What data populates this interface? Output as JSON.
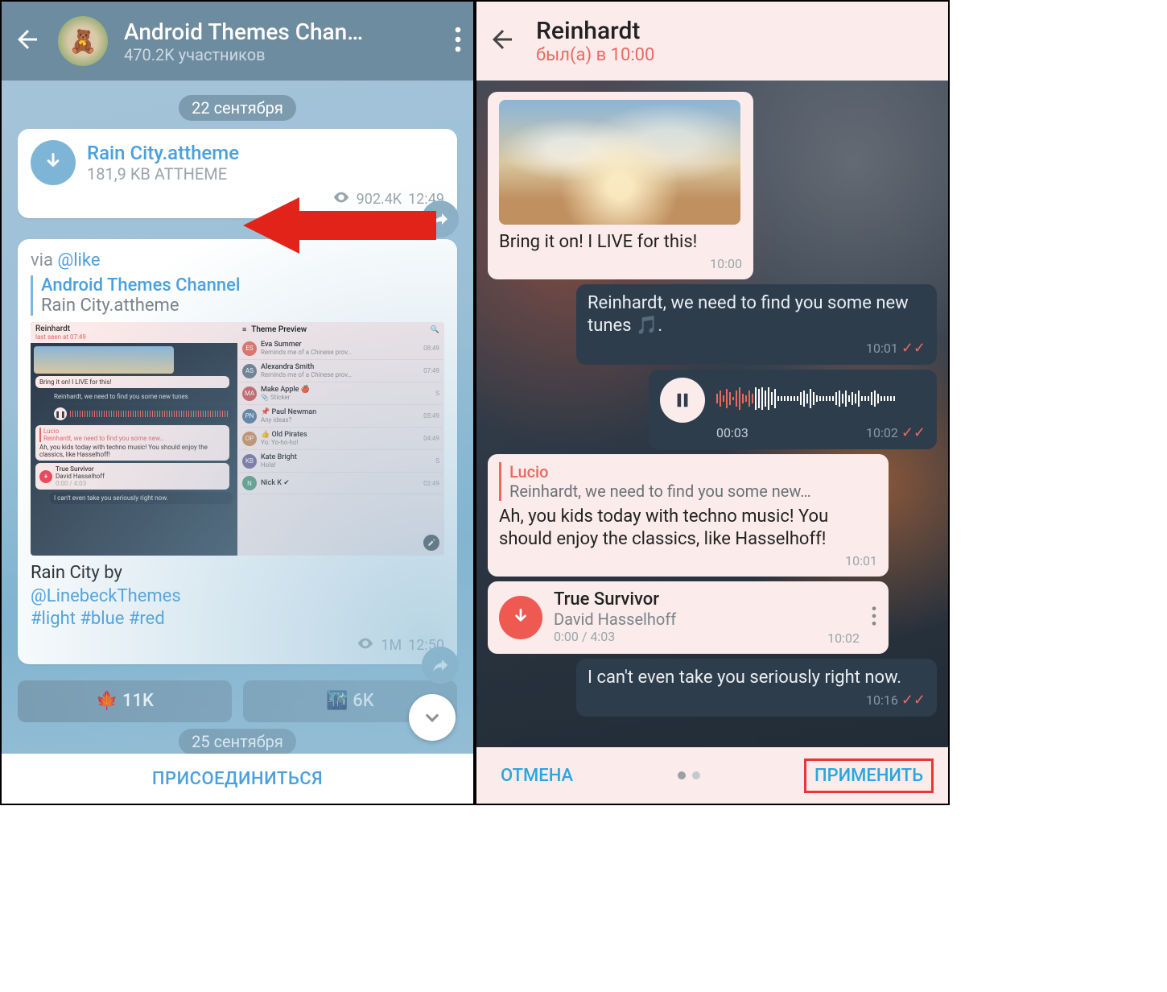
{
  "left": {
    "header": {
      "title": "Android Themes Chan…",
      "subscribers": "470.2K участников"
    },
    "dates": {
      "d1": "22 сентября",
      "d2": "25 сентября"
    },
    "file_msg": {
      "name": "Rain City.attheme",
      "meta": "181,9 KB ATTHEME",
      "views": "902.4K",
      "time": "12:49"
    },
    "post": {
      "via_prefix": "via ",
      "via_handle": "@like",
      "quote_source": "Android Themes Channel",
      "quote_text": "Rain City.attheme",
      "caption_line1": "Rain City by",
      "caption_link": "@LinebeckThemes",
      "caption_tags": "#light #blue #red",
      "views": "1M",
      "time": "12:50"
    },
    "reactions": {
      "r1": "🍁 11K",
      "r2": "🌃 6K"
    },
    "preview": {
      "chat_name": "Reinhardt",
      "last_seen": "last seen at 07:49",
      "m1": "Bring it on! I LIVE for this!",
      "m2": "Reinhardt, we need to find you some new tunes",
      "reply_name": "Lucio",
      "reply_line": "Reinhardt, we need to find you some new…",
      "m3": "Ah, you kids today with techno music! You should enjoy the classics, like Hasselhoff!",
      "song": "True Survivor",
      "artist": "David Hasselhoff",
      "dur": "0:00 / 4:03",
      "m4": "I can't even take you seriously right now.",
      "list_title": "Theme Preview",
      "items": [
        {
          "av": "ES",
          "col": "#e96a5e",
          "name": "Eva Summer",
          "msg": "Reminds me of a Chinese prov…",
          "time": "08:49"
        },
        {
          "av": "AS",
          "col": "#6a7a8a",
          "name": "Alexandra Smith",
          "msg": "Reminds me of a Chinese prov…",
          "time": "07:49"
        },
        {
          "av": "MA",
          "col": "#d05a5a",
          "name": "Make Apple 🍎",
          "msg": "📎 Sticker",
          "time": "S"
        },
        {
          "av": "PN",
          "col": "#5a7a9a",
          "name": "📌 Paul Newman",
          "msg": "Any ideas?",
          "time": "05:49"
        },
        {
          "av": "OP",
          "col": "#d08a5a",
          "name": "👍 Old Pirates",
          "msg": "Yo: Yo-ho-ho!",
          "time": "04:49"
        },
        {
          "av": "KB",
          "col": "#7a6a9a",
          "name": "Kate Bright",
          "msg": "Hola!",
          "time": "S"
        },
        {
          "av": "N",
          "col": "#5a9a7a",
          "name": "Nick K ✔",
          "msg": "",
          "time": "02:49"
        }
      ]
    },
    "join": "ПРИСОЕДИНИТЬСЯ"
  },
  "right": {
    "header": {
      "title": "Reinhardt",
      "status": "был(а) в 10:00"
    },
    "m_img": {
      "text": "Bring it on! I LIVE for this!",
      "time": "10:00"
    },
    "m_out1": {
      "text": "Reinhardt, we need to find you some new tunes 🎵.",
      "time": "10:01"
    },
    "m_voice": {
      "elapsed": "00:03",
      "time": "10:02"
    },
    "m_reply": {
      "reply_name": "Lucio",
      "reply_text": "Reinhardt, we need to find you some new…",
      "text": "Ah, you kids today with techno music! You should enjoy the classics, like Hasselhoff!",
      "time": "10:01"
    },
    "m_song": {
      "title": "True Survivor",
      "artist": "David Hasselhoff",
      "duration": "0:00 / 4:03",
      "time": "10:02"
    },
    "m_out2": {
      "text": "I can't even take you seriously right now.",
      "time": "10:16"
    },
    "footer": {
      "cancel": "ОТМЕНА",
      "apply": "ПРИМЕНИТЬ"
    }
  }
}
